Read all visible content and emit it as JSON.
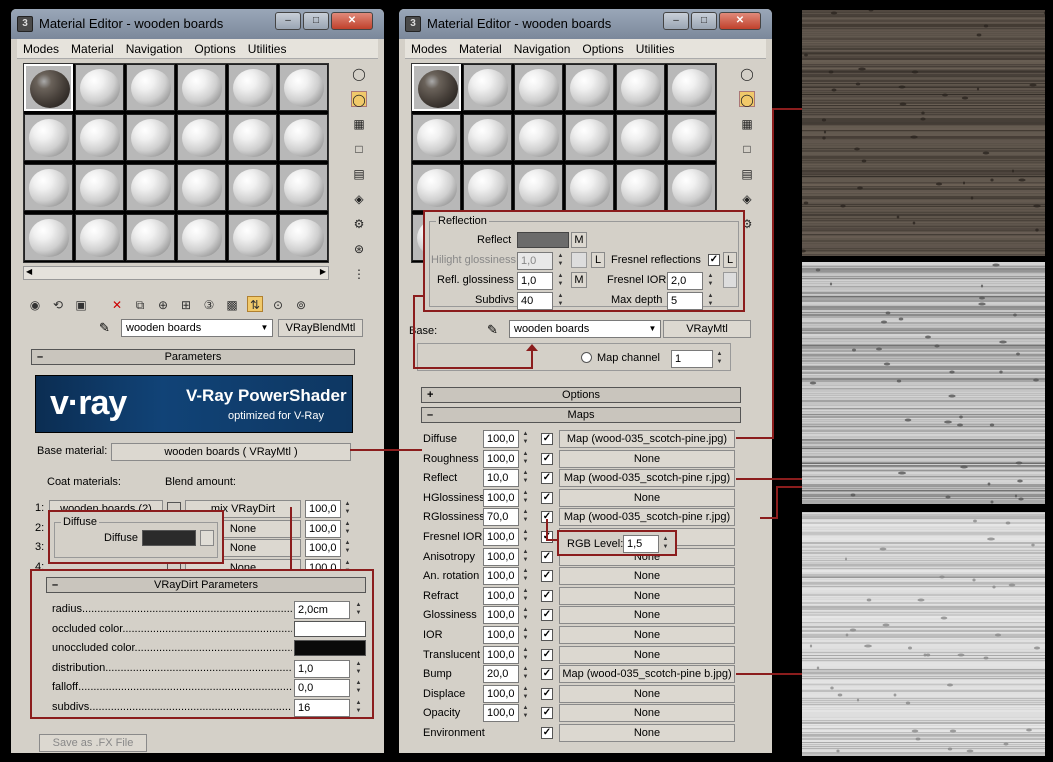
{
  "left_window": {
    "title": "Material Editor - wooden boards",
    "menu": [
      "Modes",
      "Material",
      "Navigation",
      "Options",
      "Utilities"
    ],
    "material_name": "wooden boards",
    "material_type": "VRayBlendMtl",
    "params_rollout": "Parameters",
    "vray_banner": {
      "logo": "v·ray",
      "title": "V-Ray PowerShader",
      "subtitle": "optimized for V-Ray"
    },
    "base_material_label": "Base material:",
    "base_material_value": "wooden boards ( VRayMtl )",
    "coat_materials_label": "Coat materials:",
    "blend_amount_label": "Blend amount:",
    "coat_rows": [
      {
        "index": "1:",
        "coat": "wooden boards (2)",
        "blend": "mix VRayDirt",
        "amount": "100,0"
      },
      {
        "index": "2:",
        "coat": "",
        "blend": "None",
        "amount": "100,0"
      },
      {
        "index": "3:",
        "coat": "",
        "blend": "None",
        "amount": "100,0"
      },
      {
        "index": "4:",
        "coat": "",
        "blend": "None",
        "amount": "100,0"
      }
    ],
    "diffuse_popup": {
      "group": "Diffuse",
      "label": "Diffuse",
      "color": "#2b2b2b"
    },
    "dirt_popup": {
      "title": "VRayDirt Parameters",
      "rows": [
        {
          "label": "radius",
          "value": "2,0cm"
        },
        {
          "label": "occluded color",
          "value": "",
          "color": "#ffffff"
        },
        {
          "label": "unoccluded color",
          "value": "",
          "color": "#0a0a0a"
        },
        {
          "label": "distribution",
          "value": "1,0"
        },
        {
          "label": "falloff",
          "value": "0,0"
        },
        {
          "label": "subdivs",
          "value": "16"
        }
      ]
    },
    "save_fx": "Save as .FX File"
  },
  "right_window": {
    "title": "Material Editor - wooden boards",
    "menu": [
      "Modes",
      "Material",
      "Navigation",
      "Options",
      "Utilities"
    ],
    "reflection": {
      "group": "Reflection",
      "reflect_label": "Reflect",
      "reflect_color": "#6b6b6b",
      "m_btn": "M",
      "l_btn": "L",
      "hilight_label": "Hilight glossiness",
      "hilight_value": "1,0",
      "fresnel_label": "Fresnel reflections",
      "refl_gloss_label": "Refl. glossiness",
      "refl_gloss_value": "1,0",
      "fresnel_ior_label": "Fresnel IOR",
      "fresnel_ior_value": "2,0",
      "subdivs_label": "Subdivs",
      "subdivs_value": "40",
      "max_depth_label": "Max depth",
      "max_depth_value": "5"
    },
    "base_label": "Base:",
    "material_name": "wooden boards",
    "material_type": "VRayMtl",
    "map_channel_label": "Map channel",
    "map_channel_value": "1",
    "options_rollout": "Options",
    "maps_rollout": "Maps",
    "maps": [
      {
        "name": "Diffuse",
        "amount": "100,0",
        "checked": true,
        "map": "Map  (wood-035_scotch-pine.jpg)"
      },
      {
        "name": "Roughness",
        "amount": "100,0",
        "checked": true,
        "map": "None"
      },
      {
        "name": "Reflect",
        "amount": "10,0",
        "checked": true,
        "map": "Map  (wood-035_scotch-pine r.jpg)"
      },
      {
        "name": "HGlossiness",
        "amount": "100,0",
        "checked": true,
        "map": "None"
      },
      {
        "name": "RGlossiness",
        "amount": "70,0",
        "checked": true,
        "map": "Map  (wood-035_scotch-pine r.jpg)"
      },
      {
        "name": "Fresnel IOR",
        "amount": "100,0",
        "checked": true,
        "map": "None"
      },
      {
        "name": "Anisotropy",
        "amount": "100,0",
        "checked": true,
        "map": "None"
      },
      {
        "name": "An. rotation",
        "amount": "100,0",
        "checked": true,
        "map": "None"
      },
      {
        "name": "Refract",
        "amount": "100,0",
        "checked": true,
        "map": "None"
      },
      {
        "name": "Glossiness",
        "amount": "100,0",
        "checked": true,
        "map": "None"
      },
      {
        "name": "IOR",
        "amount": "100,0",
        "checked": true,
        "map": "None"
      },
      {
        "name": "Translucent",
        "amount": "100,0",
        "checked": true,
        "map": "None"
      },
      {
        "name": "Bump",
        "amount": "20,0",
        "checked": true,
        "map": "Map (wood-035_scotch-pine b.jpg)"
      },
      {
        "name": "Displace",
        "amount": "100,0",
        "checked": true,
        "map": "None"
      },
      {
        "name": "Opacity",
        "amount": "100,0",
        "checked": true,
        "map": "None"
      },
      {
        "name": "Environment",
        "amount": "",
        "checked": true,
        "map": "None"
      }
    ],
    "rgb_level_label": "RGB Level:",
    "rgb_level_value": "1,5"
  },
  "textures": {
    "colors": {
      "diffuse": "#5a5148",
      "reflect": "#bdbdbd",
      "bump": "#d8d8d8"
    }
  }
}
